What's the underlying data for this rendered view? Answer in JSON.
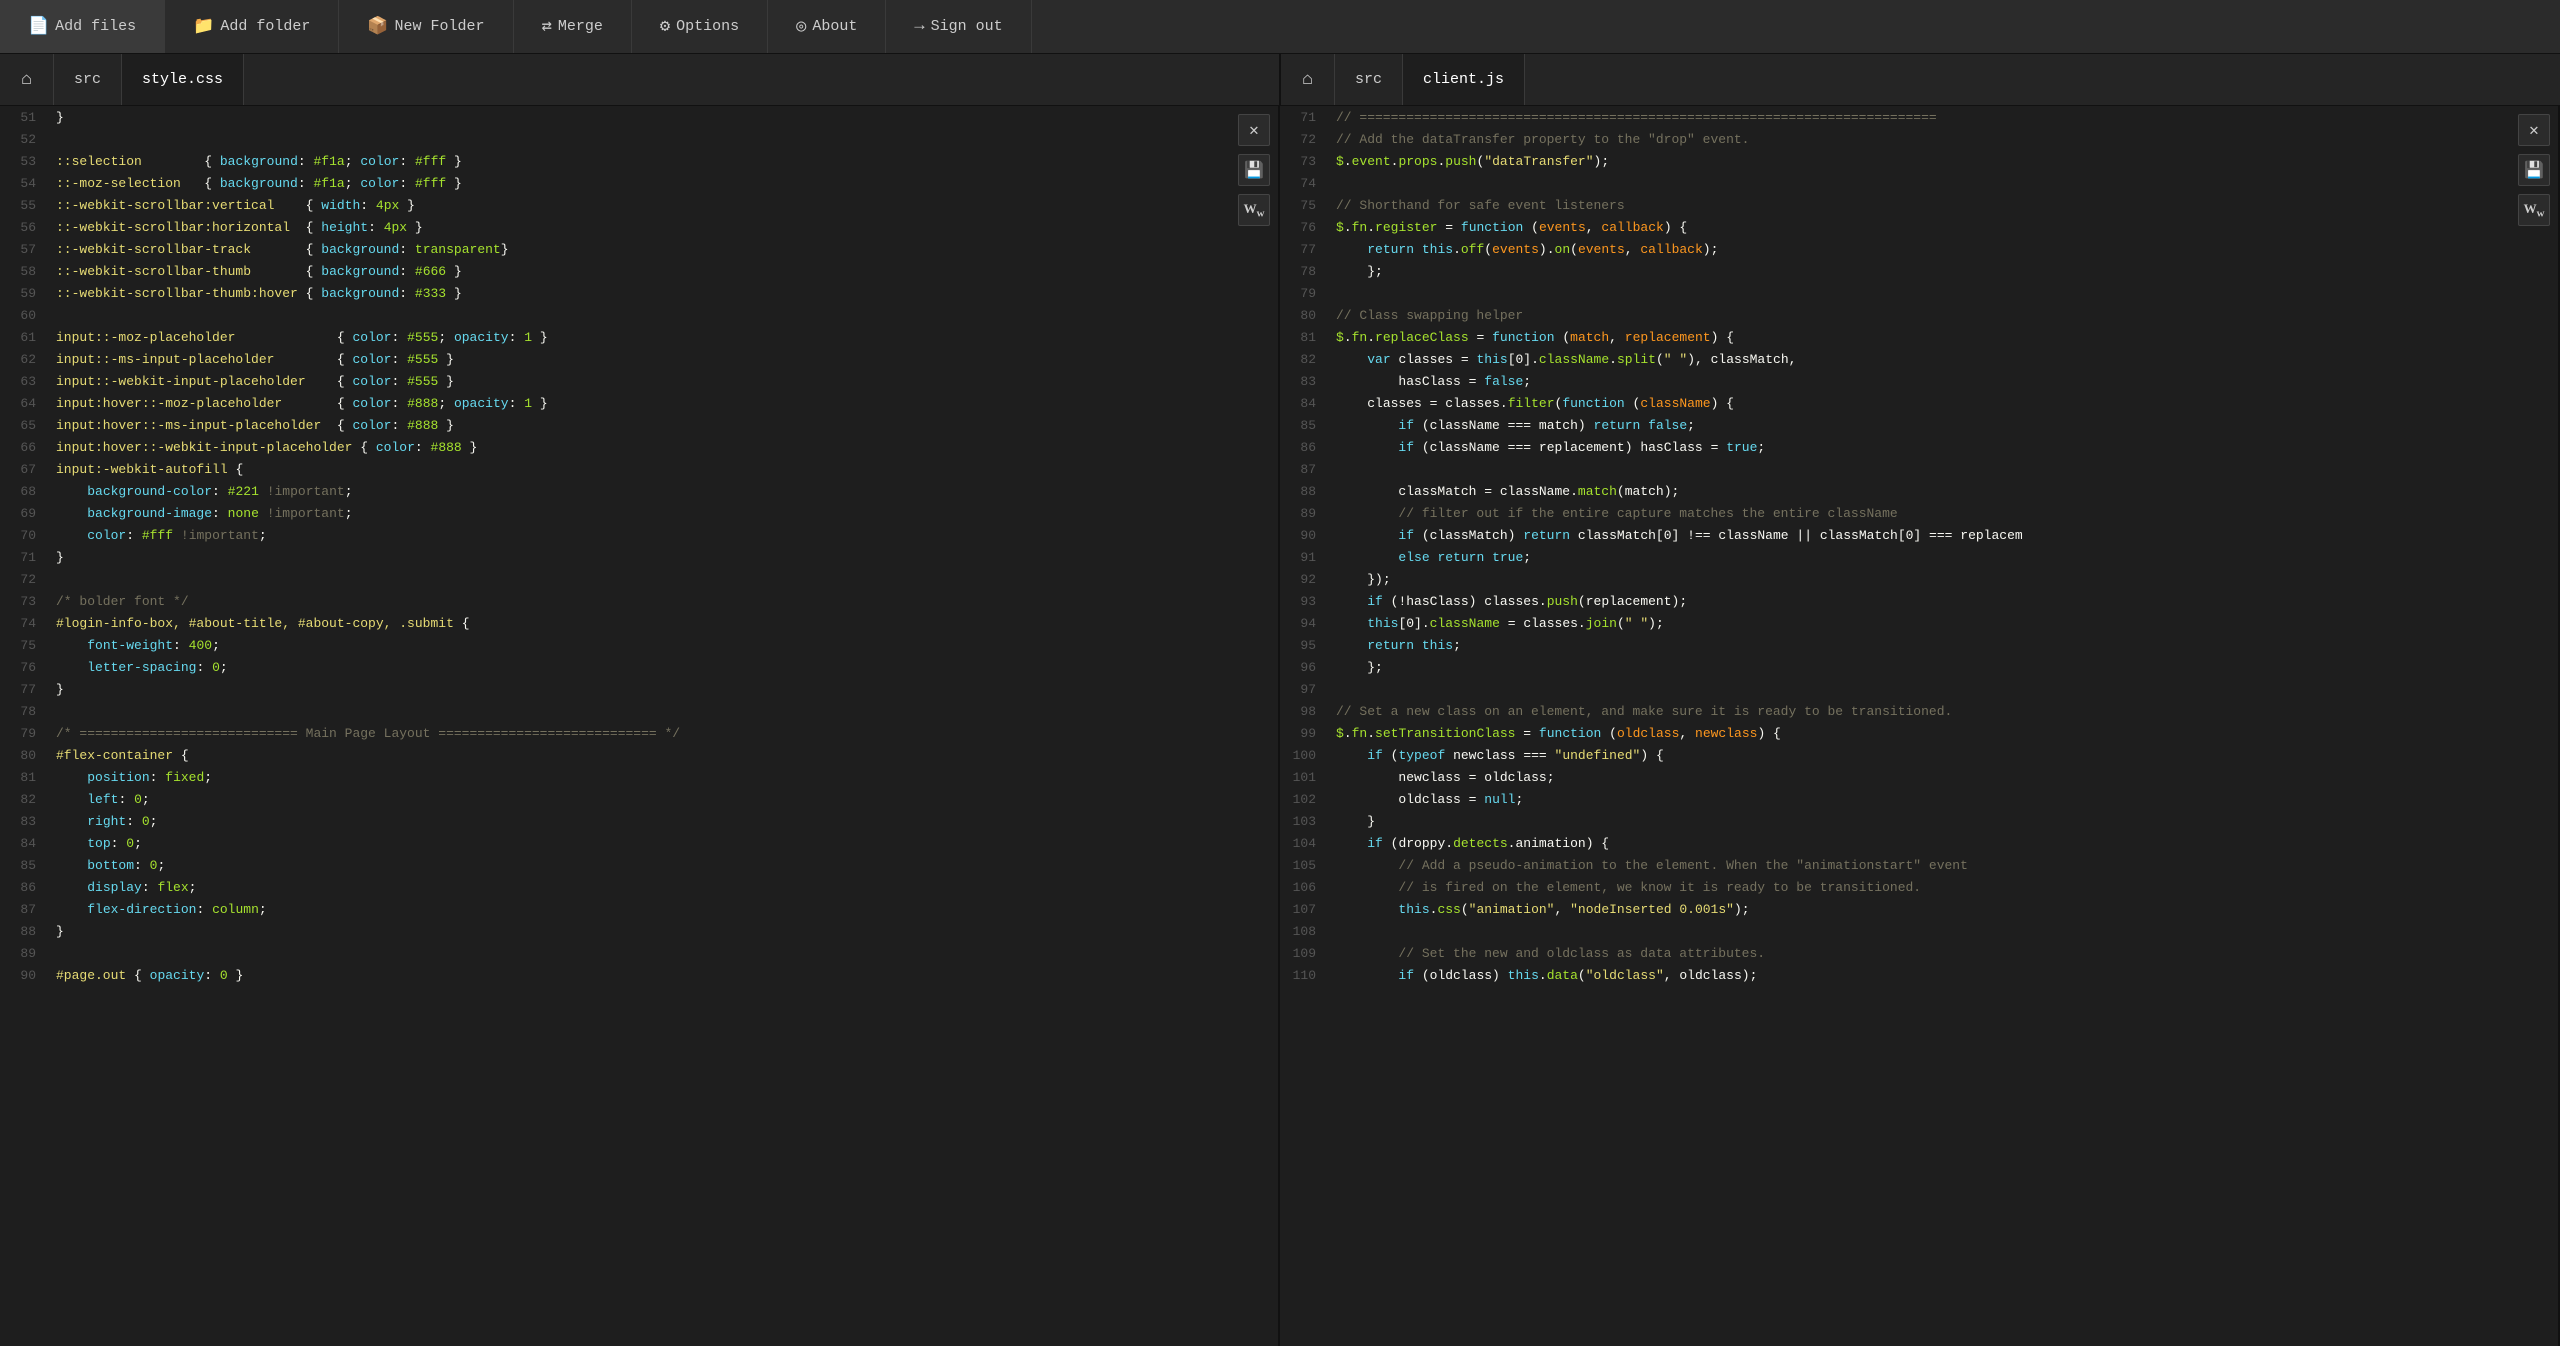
{
  "toolbar": {
    "buttons": [
      {
        "label": "Add files",
        "icon": "📄",
        "name": "add-files-button"
      },
      {
        "label": "Add folder",
        "icon": "📁",
        "name": "add-folder-button"
      },
      {
        "label": "New Folder",
        "icon": "📦",
        "name": "new-folder-button"
      },
      {
        "label": "Merge",
        "icon": "⇄",
        "name": "merge-button"
      },
      {
        "label": "Options",
        "icon": "⚙",
        "name": "options-button"
      },
      {
        "label": "About",
        "icon": "◎",
        "name": "about-button"
      },
      {
        "label": "Sign out",
        "icon": "→",
        "name": "sign-out-button"
      }
    ]
  },
  "left_panel": {
    "breadcrumb_src": "src",
    "filename": "style.css",
    "lines": []
  },
  "right_panel": {
    "breadcrumb_src": "src",
    "filename": "client.js",
    "lines": []
  },
  "icons": {
    "home": "⌂",
    "close": "✕",
    "save": "💾",
    "Ww": "Ww"
  }
}
